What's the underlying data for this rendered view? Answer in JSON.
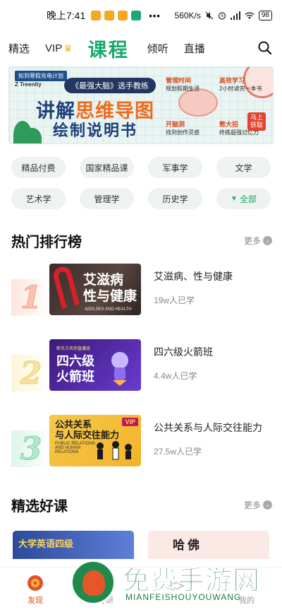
{
  "status_bar": {
    "time": "晚上7:41",
    "dots": "•••",
    "network_speed": "560K/s",
    "battery": "98",
    "app_colors": [
      "#f5a623",
      "#f5a623",
      "#f5a623",
      "#19a974"
    ]
  },
  "top_nav": {
    "items": [
      "精选",
      "VIP",
      "课程",
      "倾听",
      "直播"
    ],
    "active_index": 2
  },
  "banner": {
    "tag": "知到寒假充电计划",
    "logo": "Z Treenity",
    "subtitle": "《最强大脑》选手教练",
    "title_prefix": "讲解",
    "title_highlight": "思维导图",
    "title_line2": "绘制说明书",
    "notes": [
      {
        "head": "管理时间",
        "body": "规划假期生活"
      },
      {
        "head": "高效学习",
        "body": "2小时读完一本书"
      },
      {
        "head": "开脑洞",
        "body": "找到创作灵感"
      },
      {
        "head": "憋大招",
        "body": "终练超强记忆力"
      }
    ],
    "cta": "马上获取"
  },
  "categories": [
    "精品付费",
    "国家精品课",
    "军事学",
    "文学",
    "艺术学",
    "管理学",
    "历史学",
    "全部"
  ],
  "ranking": {
    "title": "热门排行榜",
    "more": "更多",
    "items": [
      {
        "rank": "1",
        "title": "艾滋病、性与健康",
        "learners": "19w人已学",
        "thumb_title": "艾滋病\n性与健康",
        "thumb_sub": "AIDS,SEX AND HEALTH"
      },
      {
        "rank": "2",
        "title": "四六级火箭班",
        "learners": "4.4w人已学",
        "thumb_title": "四六级\n火箭班",
        "thumb_sub": "新东方名师直播班"
      },
      {
        "rank": "3",
        "title": "公共关系与人际交往能力",
        "learners": "27.5w人已学",
        "thumb_title": "公共关系\n与人际交往能力",
        "thumb_sub": "PUBLIC RELATIONS AND HUMAN RELATIONS",
        "thumb_badge": "VIP"
      }
    ]
  },
  "featured": {
    "title": "精选好课",
    "more": "更多",
    "cards": [
      "大学英语四级",
      "哈佛"
    ]
  },
  "tab_bar": {
    "items": [
      "发现",
      "考研",
      "",
      "我的"
    ],
    "active_index": 0
  },
  "watermark": {
    "text": "免费手游网",
    "sub": "MIANFEISHOUYOUWANG"
  }
}
